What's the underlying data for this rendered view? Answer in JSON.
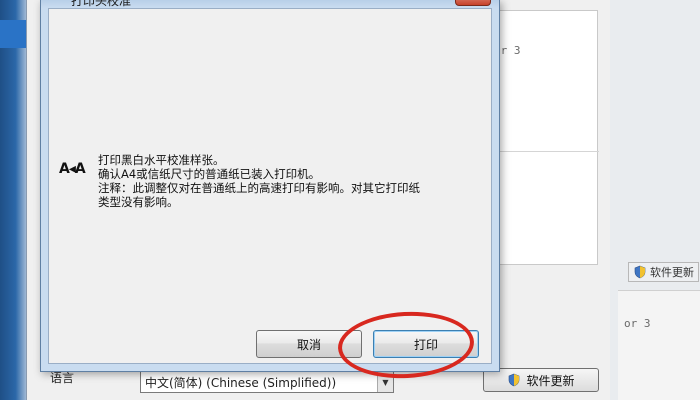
{
  "background_window": {
    "panel_text": "or 3",
    "small_update_label": "软件更新",
    "lower_right_text": "or 3",
    "language_label": "语言",
    "language_value": "中文(简体) (Chinese (Simplified))",
    "update_button_label": "软件更新"
  },
  "dialog": {
    "title": "打印头校准",
    "message_lines": [
      "打印黑白水平校准样张。",
      "确认A4或信纸尺寸的普通纸已装入打印机。",
      "注释：此调整仅对在普通纸上的高速打印有影响。对其它打印纸",
      "类型没有影响。"
    ],
    "cancel_label": "取消",
    "print_label": "打印"
  },
  "colors": {
    "annotation_circle": "#d8281f",
    "dialog_frame": "#c9dcf0"
  }
}
